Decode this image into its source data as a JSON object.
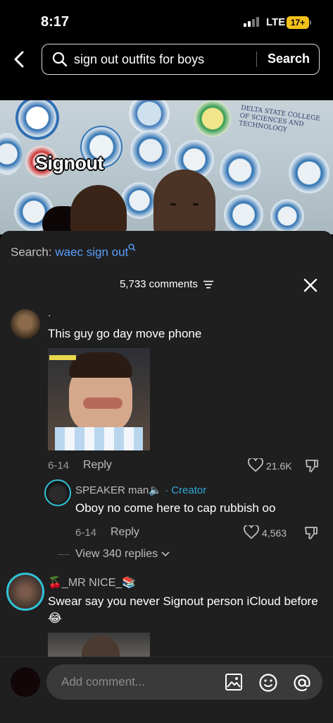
{
  "status_bar": {
    "time": "8:17",
    "network": "LTE",
    "battery": "17+"
  },
  "search": {
    "query": "sign out outfits for boys",
    "button": "Search"
  },
  "video": {
    "caption": "Signout",
    "banner_text": "DELTA STATE COLLEGE OF SCIENCES AND TECHNOLOGY"
  },
  "comments": {
    "related_label": "Search:",
    "related_query": "waec sign out",
    "count_label": "5,733 comments",
    "items": [
      {
        "username": ".",
        "text": "This guy go day move phone",
        "date": "6-14",
        "reply_label": "Reply",
        "likes": "21.6K",
        "replies": [
          {
            "username": "SPEAKER man🔈",
            "badge": "· Creator",
            "text": "Oboy no come here to cap rubbish oo",
            "date": "6-14",
            "reply_label": "Reply",
            "likes": "4,563"
          }
        ],
        "view_replies": "View 340 replies"
      },
      {
        "username": "🍒_MR NICE_📚",
        "text": "Swear say you never Signout person iCloud before 😂"
      }
    ]
  },
  "composer": {
    "placeholder": "Add comment..."
  },
  "icons": [
    "back-icon",
    "search-icon",
    "filter-icon",
    "close-icon",
    "heart-icon",
    "dislike-icon",
    "image-icon",
    "emoji-icon",
    "mention-icon"
  ],
  "colors": {
    "accent_blue": "#5aa0ff",
    "creator": "#30a9d8",
    "battery": "#f4c21b",
    "sheet": "#1f1f1f"
  }
}
